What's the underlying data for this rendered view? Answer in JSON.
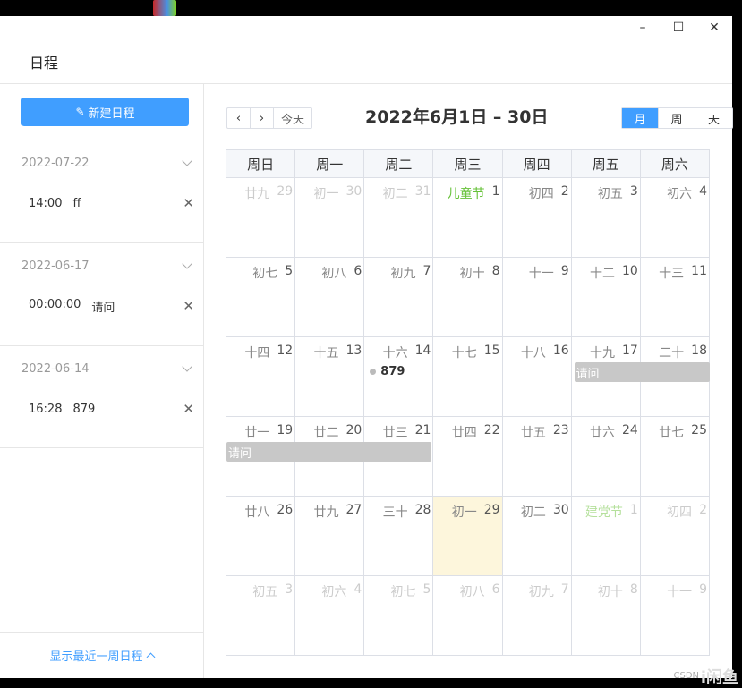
{
  "window": {
    "minimize": "–",
    "maximize": "☐",
    "close": "✕"
  },
  "app_title": "日程",
  "sidebar": {
    "new_button": "新建日程",
    "groups": [
      {
        "date": "2022-07-22",
        "time": "14:00",
        "title": "ff"
      },
      {
        "date": "2022-06-17",
        "time": "00:00:00",
        "title": "请问"
      },
      {
        "date": "2022-06-14",
        "time": "16:28",
        "title": "879"
      }
    ],
    "footer": "显示最近一周日程"
  },
  "toolbar": {
    "prev": "‹",
    "next": "›",
    "today": "今天",
    "title": "2022年6月1日 – 30日",
    "views": [
      "月",
      "周",
      "天"
    ],
    "active_view": "月"
  },
  "weekdays": [
    "周日",
    "周一",
    "周二",
    "周三",
    "周四",
    "周五",
    "周六"
  ],
  "weeks": [
    [
      {
        "lunar": "廿九",
        "num": "29",
        "other": true
      },
      {
        "lunar": "初一",
        "num": "30",
        "other": true
      },
      {
        "lunar": "初二",
        "num": "31",
        "other": true
      },
      {
        "lunar": "儿童节",
        "num": "1",
        "festival": true
      },
      {
        "lunar": "初四",
        "num": "2"
      },
      {
        "lunar": "初五",
        "num": "3"
      },
      {
        "lunar": "初六",
        "num": "4"
      }
    ],
    [
      {
        "lunar": "初七",
        "num": "5"
      },
      {
        "lunar": "初八",
        "num": "6"
      },
      {
        "lunar": "初九",
        "num": "7"
      },
      {
        "lunar": "初十",
        "num": "8"
      },
      {
        "lunar": "十一",
        "num": "9"
      },
      {
        "lunar": "十二",
        "num": "10"
      },
      {
        "lunar": "十三",
        "num": "11"
      }
    ],
    [
      {
        "lunar": "十四",
        "num": "12"
      },
      {
        "lunar": "十五",
        "num": "13"
      },
      {
        "lunar": "十六",
        "num": "14"
      },
      {
        "lunar": "十七",
        "num": "15"
      },
      {
        "lunar": "十八",
        "num": "16"
      },
      {
        "lunar": "十九",
        "num": "17"
      },
      {
        "lunar": "二十",
        "num": "18"
      }
    ],
    [
      {
        "lunar": "廿一",
        "num": "19"
      },
      {
        "lunar": "廿二",
        "num": "20"
      },
      {
        "lunar": "廿三",
        "num": "21"
      },
      {
        "lunar": "廿四",
        "num": "22"
      },
      {
        "lunar": "廿五",
        "num": "23"
      },
      {
        "lunar": "廿六",
        "num": "24"
      },
      {
        "lunar": "廿七",
        "num": "25"
      }
    ],
    [
      {
        "lunar": "廿八",
        "num": "26"
      },
      {
        "lunar": "廿九",
        "num": "27"
      },
      {
        "lunar": "三十",
        "num": "28"
      },
      {
        "lunar": "初一",
        "num": "29",
        "today": true
      },
      {
        "lunar": "初二",
        "num": "30"
      },
      {
        "lunar": "建党节",
        "num": "1",
        "other": true,
        "festival": true
      },
      {
        "lunar": "初四",
        "num": "2",
        "other": true
      }
    ],
    [
      {
        "lunar": "初五",
        "num": "3",
        "other": true
      },
      {
        "lunar": "初六",
        "num": "4",
        "other": true
      },
      {
        "lunar": "初七",
        "num": "5",
        "other": true
      },
      {
        "lunar": "初八",
        "num": "6",
        "other": true
      },
      {
        "lunar": "初九",
        "num": "7",
        "other": true
      },
      {
        "lunar": "初十",
        "num": "8",
        "other": true
      },
      {
        "lunar": "十一",
        "num": "9",
        "other": true
      }
    ]
  ],
  "events": {
    "dot_event": "879",
    "bar_event_1": "请问",
    "bar_event_2": "请问"
  },
  "watermark": "i闲鱼",
  "watermark_small": "CSDN"
}
